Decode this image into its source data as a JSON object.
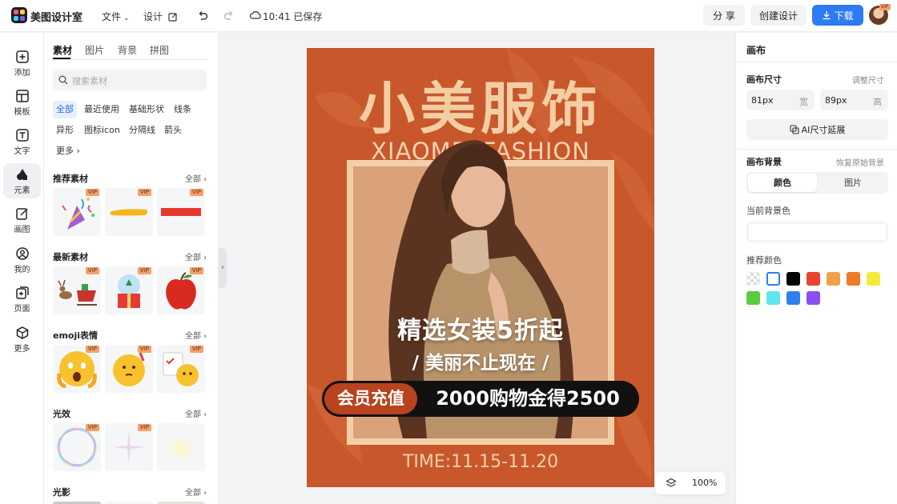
{
  "app": {
    "name": "美图设计室"
  },
  "topbar": {
    "file_menu": "文件",
    "design_menu": "设计",
    "save_status": "10:41 已保存",
    "share_label": "分 享",
    "create_label": "创建设计",
    "download_label": "下载",
    "avatar_badge": "VIP"
  },
  "sidebar": {
    "items": [
      {
        "label": "添加",
        "icon": "plus-square-icon"
      },
      {
        "label": "模板",
        "icon": "template-icon"
      },
      {
        "label": "文字",
        "icon": "text-icon"
      },
      {
        "label": "元素",
        "icon": "shapes-icon"
      },
      {
        "label": "画图",
        "icon": "pen-icon"
      },
      {
        "label": "我的",
        "icon": "user-icon"
      },
      {
        "label": "页面",
        "icon": "page-add-icon"
      },
      {
        "label": "更多",
        "icon": "cube-icon"
      }
    ],
    "active": "元素"
  },
  "panel": {
    "tabs": [
      "素材",
      "图片",
      "背景",
      "拼图"
    ],
    "search_placeholder": "搜索素材",
    "chips": [
      "全部",
      "最近使用",
      "基础形状",
      "线条",
      "异形",
      "图标icon",
      "分隔线",
      "箭头",
      "更多"
    ],
    "vip": "VIP",
    "all_label": "全部",
    "sections": [
      {
        "title": "推荐素材"
      },
      {
        "title": "最新素材"
      },
      {
        "title": "emoji表情"
      },
      {
        "title": "光效"
      },
      {
        "title": "光影"
      }
    ]
  },
  "poster": {
    "title": "小美服饰",
    "subtitle_en": "XIAOMEI FASHION",
    "headline": "精选女装5折起",
    "tagline": "/ 美丽不止现在 /",
    "member_label": "会员充值",
    "offer": "2000购物金得2500",
    "time": "TIME:11.15-11.20"
  },
  "zoom": {
    "value": "100%"
  },
  "right_panel": {
    "title": "画布",
    "size_label": "画布尺寸",
    "resize_label": "调整尺寸",
    "width_value": "81px",
    "width_unit": "宽",
    "height_value": "89px",
    "height_unit": "高",
    "ai_extend_label": "AI尺寸延展",
    "bg_label": "画布背景",
    "restore_label": "恢复原始背景",
    "seg_color": "颜色",
    "seg_image": "图片",
    "current_bg_label": "当前背景色",
    "recommend_label": "推荐颜色",
    "swatches": [
      "transparent",
      "#ffffff",
      "#000000",
      "#e8432e",
      "#f2a14a",
      "#ee7a2c",
      "#f5ea3a",
      "#5acb3f",
      "#5de6ee",
      "#2f7ff0",
      "#8a4ff0"
    ]
  }
}
